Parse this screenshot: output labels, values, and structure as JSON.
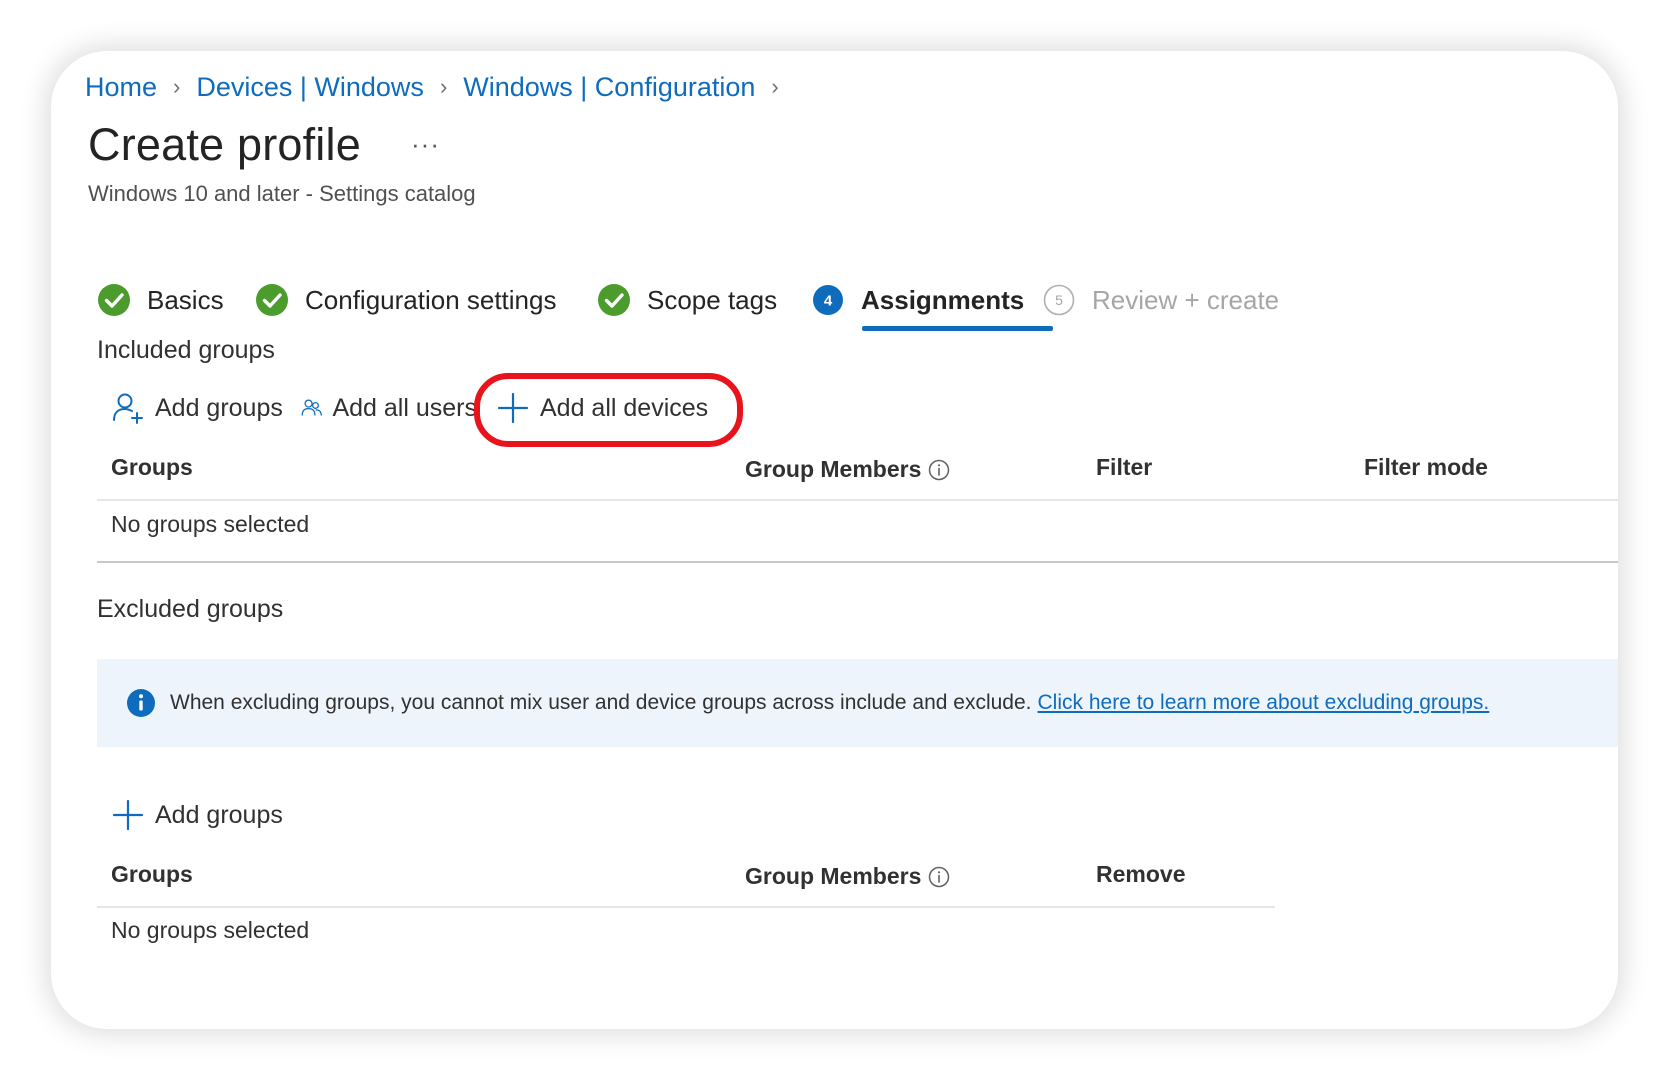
{
  "breadcrumb": {
    "items": [
      {
        "label": "Home"
      },
      {
        "label": "Devices | Windows"
      },
      {
        "label": "Windows | Configuration"
      }
    ],
    "separator": ">"
  },
  "header": {
    "title": "Create profile",
    "more_label": "···",
    "subtitle": "Windows 10 and later - Settings catalog"
  },
  "wizard": {
    "steps": [
      {
        "label": "Basics",
        "state": "complete",
        "icon": "check-circle-icon"
      },
      {
        "label": "Configuration settings",
        "state": "complete",
        "icon": "check-circle-icon"
      },
      {
        "label": "Scope tags",
        "state": "complete",
        "icon": "check-circle-icon"
      },
      {
        "label": "Assignments",
        "state": "active",
        "number": "4"
      },
      {
        "label": "Review + create",
        "state": "disabled",
        "number": "5"
      }
    ]
  },
  "included": {
    "title": "Included groups",
    "actions": {
      "add_groups": "Add groups",
      "add_all_users": "Add all users",
      "add_all_devices": "Add all devices"
    },
    "table": {
      "headers": {
        "groups": "Groups",
        "members": "Group Members",
        "filter": "Filter",
        "filter_mode": "Filter mode"
      },
      "empty": "No groups selected"
    }
  },
  "excluded": {
    "title": "Excluded groups",
    "info": {
      "text": "When excluding groups, you cannot mix user and device groups across include and exclude.",
      "link": "Click here to learn more about excluding groups."
    },
    "actions": {
      "add_groups": "Add groups"
    },
    "table": {
      "headers": {
        "groups": "Groups",
        "members": "Group Members",
        "remove": "Remove"
      },
      "empty": "No groups selected"
    }
  },
  "colors": {
    "accent": "#0f6cbd",
    "success": "#4b9c2d",
    "highlight": "#e8131b",
    "info_bg": "#eef4fc"
  }
}
